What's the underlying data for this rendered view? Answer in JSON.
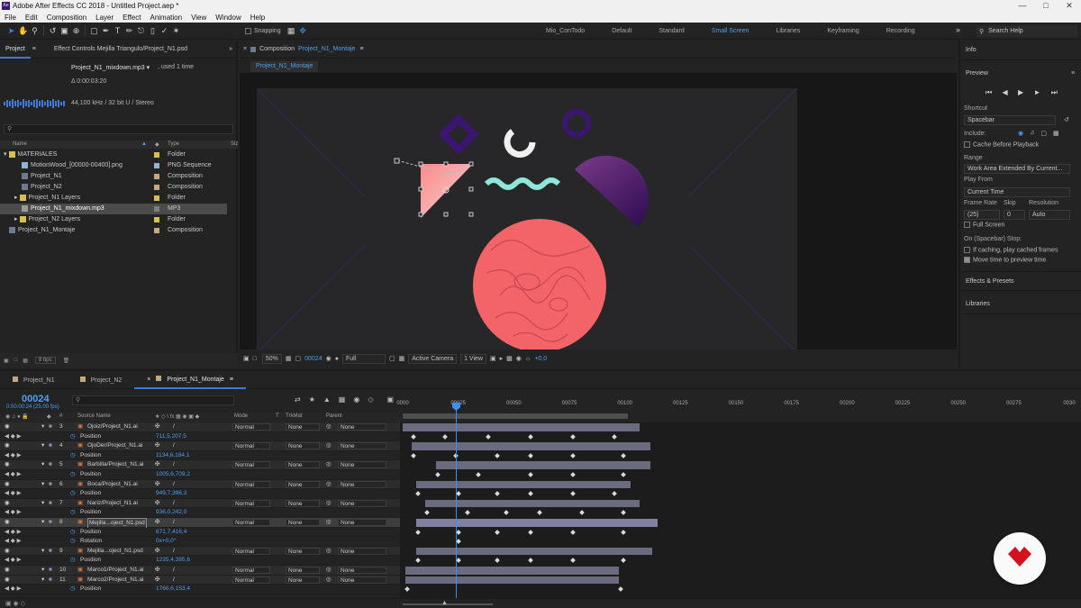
{
  "window": {
    "title": "Adobe After Effects CC 2018 - Untitled Project.aep *",
    "app_icon": "Ae"
  },
  "menu": [
    "File",
    "Edit",
    "Composition",
    "Layer",
    "Effect",
    "Animation",
    "View",
    "Window",
    "Help"
  ],
  "toolbar": {
    "snapping_label": "Snapping",
    "workspaces": [
      "Mio_ConTodo",
      "Default",
      "Standard",
      "Small Screen",
      "Libraries",
      "Keyframing",
      "Recording"
    ],
    "active_workspace": "Small Screen",
    "search_placeholder": "Search Help",
    "accent": "#4f9ff0"
  },
  "project_panel": {
    "tab_project": "Project",
    "tab_effects": "Effect Controls Mejilla Triangulo/Project_N1.psd",
    "selected_name": "Project_N1_mixdown.mp3 ▾",
    "used_count": ", used 1 time",
    "duration": "Δ 0:00:03:20",
    "audio_info": "44,100 kHz / 32 bit U / Stereo",
    "col_name": "Name",
    "col_type": "Type",
    "col_size": "Siz",
    "items": [
      {
        "name": "MATERIALES",
        "type": "Folder",
        "color": "#d8c04a",
        "indent": 0
      },
      {
        "name": "MotionWood_[00000-00400].png",
        "type": "PNG Sequence",
        "color": "#8fb3d1",
        "indent": 1
      },
      {
        "name": "Project_N1",
        "type": "Composition",
        "color": "#c6a87a",
        "indent": 1
      },
      {
        "name": "Project_N2",
        "type": "Composition",
        "color": "#c6a87a",
        "indent": 1
      },
      {
        "name": "Project_N1 Layers",
        "type": "Folder",
        "color": "#d8c04a",
        "indent": 1
      },
      {
        "name": "Project_N1_mixdown.mp3",
        "type": "MP3",
        "color": "#7d7d7d",
        "indent": 1,
        "selected": true
      },
      {
        "name": "Project_N2 Layers",
        "type": "Folder",
        "color": "#d8c04a",
        "indent": 1
      },
      {
        "name": "Project_N1_Montaje",
        "type": "Composition",
        "color": "#c6a87a",
        "indent": 0
      }
    ],
    "bpc": "8 bpc"
  },
  "composition": {
    "header": "Composition",
    "comp_name": "Project_N1_Montaje",
    "tab_label": "Project_N1_Montaje",
    "zoom": "50%",
    "timecode": "00024",
    "resolution": "Full",
    "camera": "Active Camera",
    "views": "1 View",
    "exposure": "+0,0"
  },
  "right_panel": {
    "info_label": "Info",
    "preview_label": "Preview",
    "shortcut_label": "Shortcut",
    "shortcut_value": "Spacebar",
    "include_label": "Include:",
    "cache_label": "Cache Before Playback",
    "range_label": "Range",
    "range_value": "Work Area Extended By Current...",
    "play_from_label": "Play From",
    "play_from_value": "Current Time",
    "frame_rate_label": "Frame Rate",
    "skip_label": "Skip",
    "resolution_label": "Resolution",
    "frame_rate_value": "(25)",
    "skip_value": "0",
    "resolution_value": "Auto",
    "full_screen_label": "Full Screen",
    "on_stop_label": "On (Spacebar) Stop:",
    "if_caching_label": "If caching, play cached frames",
    "move_time_label": "Move time to preview time",
    "effects_presets": "Effects & Presets",
    "libraries": "Libraries"
  },
  "timeline": {
    "tabs": [
      "Project_N1",
      "Project_N2",
      "Project_N1_Montaje"
    ],
    "active_tab": "Project_N1_Montaje",
    "current_time": "00024",
    "fps": "0:00:00:24 (25.00 fps)",
    "col_source": "Source Name",
    "col_mode": "Mode",
    "col_t": "T",
    "col_trkmat": "TrkMat",
    "col_parent": "Parent",
    "ruler": [
      "0000",
      "00025",
      "00050",
      "00075",
      "00100",
      "00125",
      "00150",
      "00175",
      "00200",
      "00225",
      "00250",
      "00275",
      "0030"
    ],
    "rows": [
      {
        "kind": "layer",
        "num": "3",
        "name": "Ojoiz/Project_N1.ai",
        "mode": "Normal",
        "trkmat": "None",
        "parent": "None",
        "bar": [
          0,
          263
        ]
      },
      {
        "kind": "prop",
        "name": "Position",
        "value": "711,5,207,5",
        "keys": [
          10,
          45,
          93,
          140,
          187,
          233
        ]
      },
      {
        "kind": "layer",
        "num": "4",
        "name": "OjoDer/Project_N1.ai",
        "mode": "Normal",
        "trkmat": "None",
        "parent": "None",
        "bar": [
          10,
          275
        ]
      },
      {
        "kind": "prop",
        "name": "Position",
        "value": "1134,6,184,1",
        "keys": [
          10,
          57,
          103,
          140,
          187,
          243
        ]
      },
      {
        "kind": "layer",
        "num": "5",
        "name": "Barbilla/Project_N1.ai",
        "mode": "Normal",
        "trkmat": "None",
        "parent": "None",
        "bar": [
          37,
          275
        ]
      },
      {
        "kind": "prop",
        "name": "Position",
        "value": "1005,6,709,2",
        "keys": [
          37,
          82,
          140,
          187,
          243
        ]
      },
      {
        "kind": "layer",
        "num": "6",
        "name": "Boca/Project_N1.ai",
        "mode": "Normal",
        "trkmat": "None",
        "parent": "None",
        "bar": [
          15,
          253
        ]
      },
      {
        "kind": "prop",
        "name": "Position",
        "value": "949,7,396,3",
        "keys": [
          15,
          60,
          103,
          140,
          187,
          233
        ]
      },
      {
        "kind": "layer",
        "num": "7",
        "name": "Nariz/Project_N1.ai",
        "mode": "Normal",
        "trkmat": "None",
        "parent": "None",
        "bar": [
          25,
          263
        ]
      },
      {
        "kind": "prop",
        "name": "Position",
        "value": "936,0,242,0",
        "keys": [
          25,
          70,
          113,
          150,
          197,
          243
        ]
      },
      {
        "kind": "layer",
        "num": "8",
        "name": "Mejilla...oject_N1.psd",
        "mode": "Normal",
        "trkmat": "None",
        "parent": "None",
        "bar": [
          15,
          283
        ],
        "selected": true
      },
      {
        "kind": "prop",
        "name": "Position",
        "value": "671,7,416,4",
        "keys": [
          15,
          60,
          103,
          140,
          187,
          243
        ]
      },
      {
        "kind": "prop",
        "name": "Rotation",
        "value": "0x+0,0°",
        "keys": [
          60
        ]
      },
      {
        "kind": "layer",
        "num": "9",
        "name": "Mejilla...oject_N1.psd",
        "mode": "Normal",
        "trkmat": "None",
        "parent": "None",
        "bar": [
          15,
          277
        ]
      },
      {
        "kind": "prop",
        "name": "Position",
        "value": "1235,4,395,6",
        "keys": [
          15,
          60,
          103,
          140,
          187,
          243
        ]
      },
      {
        "kind": "layer",
        "num": "10",
        "name": "Marco1/Project_N1.ai",
        "mode": "Normal",
        "trkmat": "None",
        "parent": "None",
        "bar": [
          3,
          240
        ]
      },
      {
        "kind": "layer",
        "num": "11",
        "name": "Marco2/Project_N1.ai",
        "mode": "Normal",
        "trkmat": "None",
        "parent": "None",
        "bar": [
          3,
          240
        ]
      },
      {
        "kind": "prop",
        "name": "Position",
        "value": "1766,6,153,4",
        "keys": [
          3,
          240
        ]
      }
    ]
  }
}
